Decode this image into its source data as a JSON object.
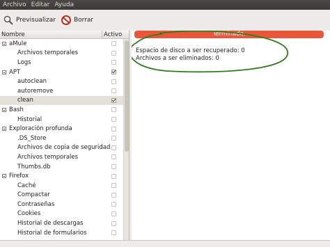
{
  "menu": [
    "Archivo",
    "Editar",
    "Ayuda"
  ],
  "toolbar": {
    "preview_label": "Previsualizar",
    "delete_label": "Borrar"
  },
  "tree": {
    "col_name": "Nombre",
    "col_active": "Activo",
    "rows": [
      {
        "label": "aMule",
        "level": 0,
        "checked": false,
        "selected": false
      },
      {
        "label": "Archivos temporales",
        "level": 1,
        "checked": false,
        "selected": false
      },
      {
        "label": "Logs",
        "level": 1,
        "checked": false,
        "selected": false
      },
      {
        "label": "APT",
        "level": 0,
        "checked": true,
        "selected": false
      },
      {
        "label": "autoclean",
        "level": 1,
        "checked": false,
        "selected": false
      },
      {
        "label": "autoremove",
        "level": 1,
        "checked": false,
        "selected": false
      },
      {
        "label": "clean",
        "level": 1,
        "checked": true,
        "selected": true
      },
      {
        "label": "Bash",
        "level": 0,
        "checked": false,
        "selected": false
      },
      {
        "label": "Historial",
        "level": 1,
        "checked": false,
        "selected": false
      },
      {
        "label": "Exploración profunda",
        "level": 0,
        "checked": false,
        "selected": false
      },
      {
        "label": ".DS_Store",
        "level": 1,
        "checked": false,
        "selected": false
      },
      {
        "label": "Archivos de copia de seguridad",
        "level": 1,
        "checked": false,
        "selected": false
      },
      {
        "label": "Archivos temporales",
        "level": 1,
        "checked": false,
        "selected": false
      },
      {
        "label": "Thumbs.db",
        "level": 1,
        "checked": false,
        "selected": false
      },
      {
        "label": "Firefox",
        "level": 0,
        "checked": false,
        "selected": false
      },
      {
        "label": "Caché",
        "level": 1,
        "checked": false,
        "selected": false
      },
      {
        "label": "Compactar",
        "level": 1,
        "checked": false,
        "selected": false
      },
      {
        "label": "Contraseñas",
        "level": 1,
        "checked": false,
        "selected": false
      },
      {
        "label": "Cookies",
        "level": 1,
        "checked": false,
        "selected": false
      },
      {
        "label": "Historial de descargas",
        "level": 1,
        "checked": false,
        "selected": false
      },
      {
        "label": "Historial de formularios",
        "level": 1,
        "checked": false,
        "selected": false
      }
    ]
  },
  "progress": {
    "text": "Terminado.",
    "fraction": 1.0,
    "color": "#e9563a"
  },
  "results": {
    "line1": "Espacio de disco a ser recuperado: 0",
    "line2": "Archivos a ser eliminados: 0"
  },
  "annotation_color": "#2e7d1a"
}
